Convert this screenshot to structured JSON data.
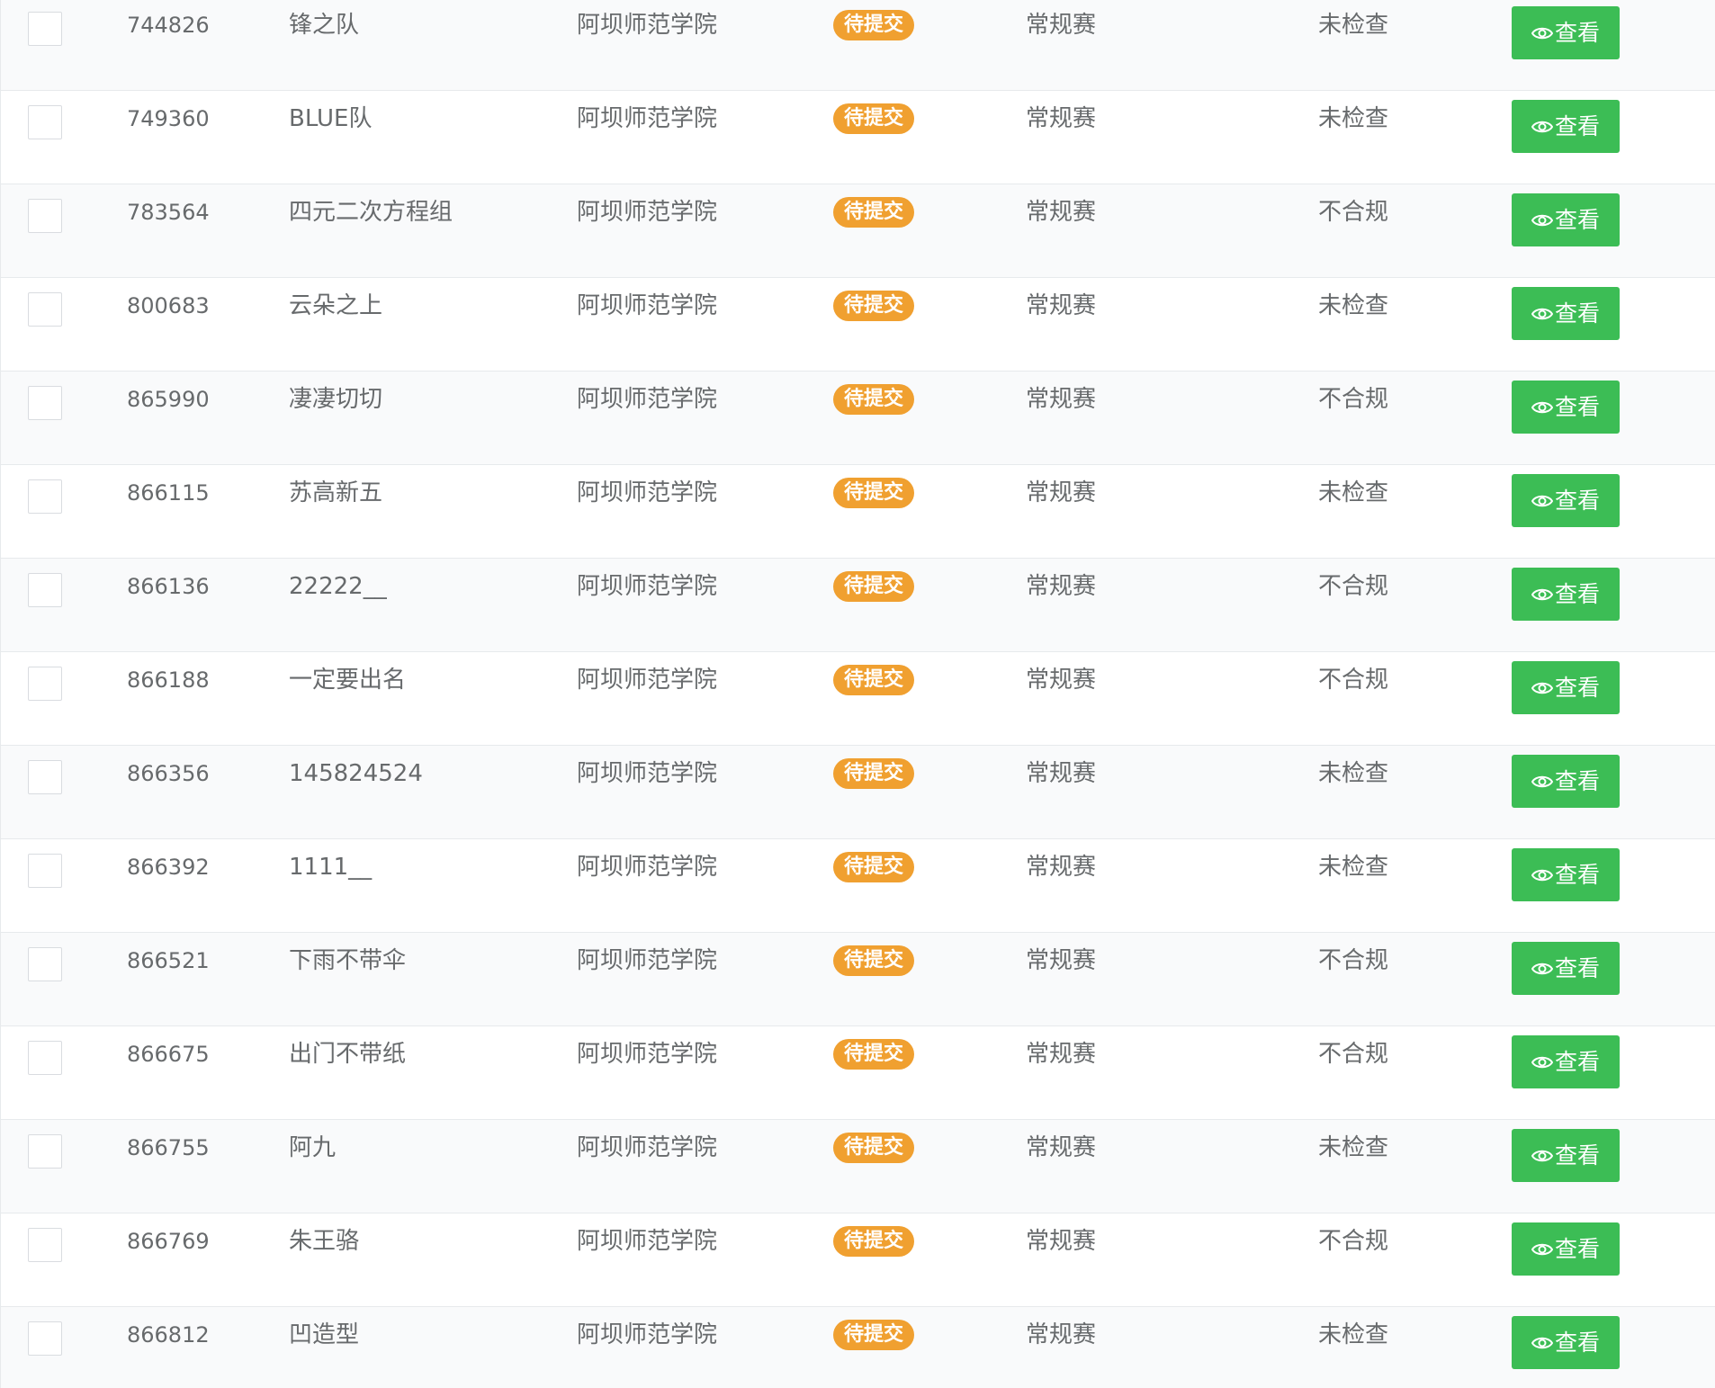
{
  "table": {
    "view_label": "查看",
    "rows": [
      {
        "id": "744826",
        "name": "锋之队",
        "school": "阿坝师范学院",
        "status": "待提交",
        "type": "常规赛",
        "check": "未检查"
      },
      {
        "id": "749360",
        "name": "BLUE队",
        "school": "阿坝师范学院",
        "status": "待提交",
        "type": "常规赛",
        "check": "未检查"
      },
      {
        "id": "783564",
        "name": "四元二次方程组",
        "school": "阿坝师范学院",
        "status": "待提交",
        "type": "常规赛",
        "check": "不合规"
      },
      {
        "id": "800683",
        "name": "云朵之上",
        "school": "阿坝师范学院",
        "status": "待提交",
        "type": "常规赛",
        "check": "未检查"
      },
      {
        "id": "865990",
        "name": "凄凄切切",
        "school": "阿坝师范学院",
        "status": "待提交",
        "type": "常规赛",
        "check": "不合规"
      },
      {
        "id": "866115",
        "name": "苏高新五",
        "school": "阿坝师范学院",
        "status": "待提交",
        "type": "常规赛",
        "check": "未检查"
      },
      {
        "id": "866136",
        "name": "22222__",
        "school": "阿坝师范学院",
        "status": "待提交",
        "type": "常规赛",
        "check": "不合规"
      },
      {
        "id": "866188",
        "name": "一定要出名",
        "school": "阿坝师范学院",
        "status": "待提交",
        "type": "常规赛",
        "check": "不合规"
      },
      {
        "id": "866356",
        "name": "145824524",
        "school": "阿坝师范学院",
        "status": "待提交",
        "type": "常规赛",
        "check": "未检查"
      },
      {
        "id": "866392",
        "name": "1111__",
        "school": "阿坝师范学院",
        "status": "待提交",
        "type": "常规赛",
        "check": "未检查"
      },
      {
        "id": "866521",
        "name": "下雨不带伞",
        "school": "阿坝师范学院",
        "status": "待提交",
        "type": "常规赛",
        "check": "不合规"
      },
      {
        "id": "866675",
        "name": "出门不带纸",
        "school": "阿坝师范学院",
        "status": "待提交",
        "type": "常规赛",
        "check": "不合规"
      },
      {
        "id": "866755",
        "name": "阿九",
        "school": "阿坝师范学院",
        "status": "待提交",
        "type": "常规赛",
        "check": "未检查"
      },
      {
        "id": "866769",
        "name": "朱王骆",
        "school": "阿坝师范学院",
        "status": "待提交",
        "type": "常规赛",
        "check": "不合规"
      },
      {
        "id": "866812",
        "name": "凹造型",
        "school": "阿坝师范学院",
        "status": "待提交",
        "type": "常规赛",
        "check": "未检查"
      }
    ]
  },
  "colors": {
    "status_badge": "#f0a030",
    "view_button": "#3cbd55",
    "row_alt": "#f9fafb",
    "text": "#676a6c"
  },
  "icons": {
    "view": "eye-icon"
  }
}
